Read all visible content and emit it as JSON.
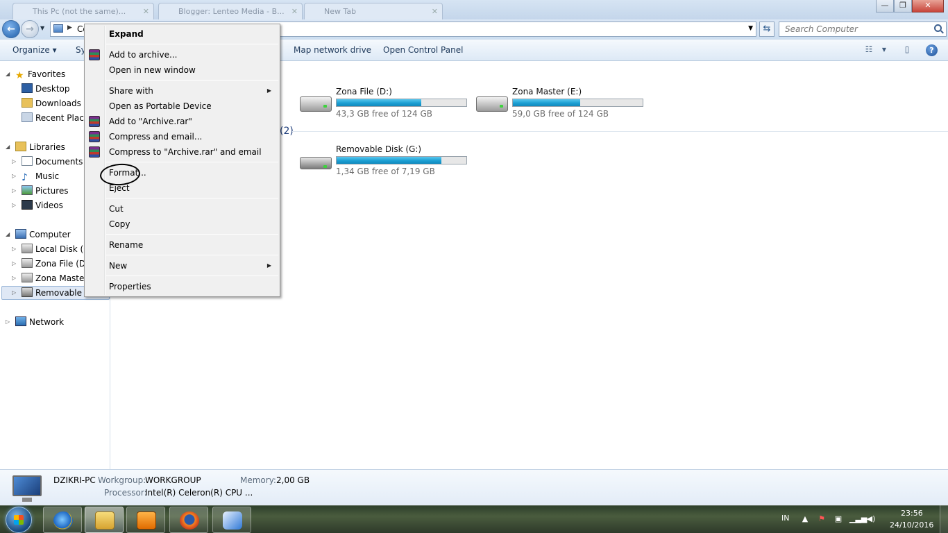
{
  "browser_tabs": [
    {
      "label": "This Pc (not the same)..."
    },
    {
      "label": "Blogger: Lenteo Media - B..."
    },
    {
      "label": "New Tab"
    }
  ],
  "address": {
    "path": "Computer",
    "search_placeholder": "Search Computer"
  },
  "toolbar": {
    "organize": "Organize",
    "system": "Sy",
    "map_drive": "Map network drive",
    "control_panel": "Open Control Panel"
  },
  "navpane": {
    "favorites": "Favorites",
    "desktop": "Desktop",
    "downloads": "Downloads",
    "recent": "Recent Places",
    "libraries": "Libraries",
    "documents": "Documents",
    "music": "Music",
    "pictures": "Pictures",
    "videos": "Videos",
    "computer": "Computer",
    "local_disk": "Local Disk (C:",
    "zona_file": "Zona File (D:)",
    "zona_master": "Zona Master",
    "removable": "Removable Di",
    "network": "Network"
  },
  "drives": [
    {
      "name": "Zona File (D:)",
      "free": "43,3 GB free of 124 GB",
      "used_fraction": 0.65
    },
    {
      "name": "Zona Master (E:)",
      "free": "59,0 GB free of 124 GB",
      "used_fraction": 0.52
    },
    {
      "name": "Removable Disk (G:)",
      "free": "1,34 GB free of 7,19 GB",
      "used_fraction": 0.81
    }
  ],
  "group_count": "(2)",
  "context_menu": {
    "expand": "Expand",
    "add_archive": "Add to archive...",
    "open_new_window": "Open in new window",
    "share_with": "Share with",
    "portable": "Open as Portable Device",
    "add_rar": "Add to \"Archive.rar\"",
    "compress_email": "Compress and email...",
    "compress_rar_email": "Compress to \"Archive.rar\" and email",
    "format": "Format...",
    "eject": "Eject",
    "cut": "Cut",
    "copy": "Copy",
    "rename": "Rename",
    "new": "New",
    "properties": "Properties"
  },
  "details": {
    "pc_name": "DZIKRI-PC",
    "workgroup_label": "Workgroup:",
    "workgroup": "WORKGROUP",
    "memory_label": "Memory:",
    "memory": "2,00 GB",
    "processor_label": "Processor:",
    "processor": "Intel(R) Celeron(R) CPU ..."
  },
  "taskbar": {
    "lang": "IN",
    "time": "23:56",
    "date": "24/10/2016"
  }
}
